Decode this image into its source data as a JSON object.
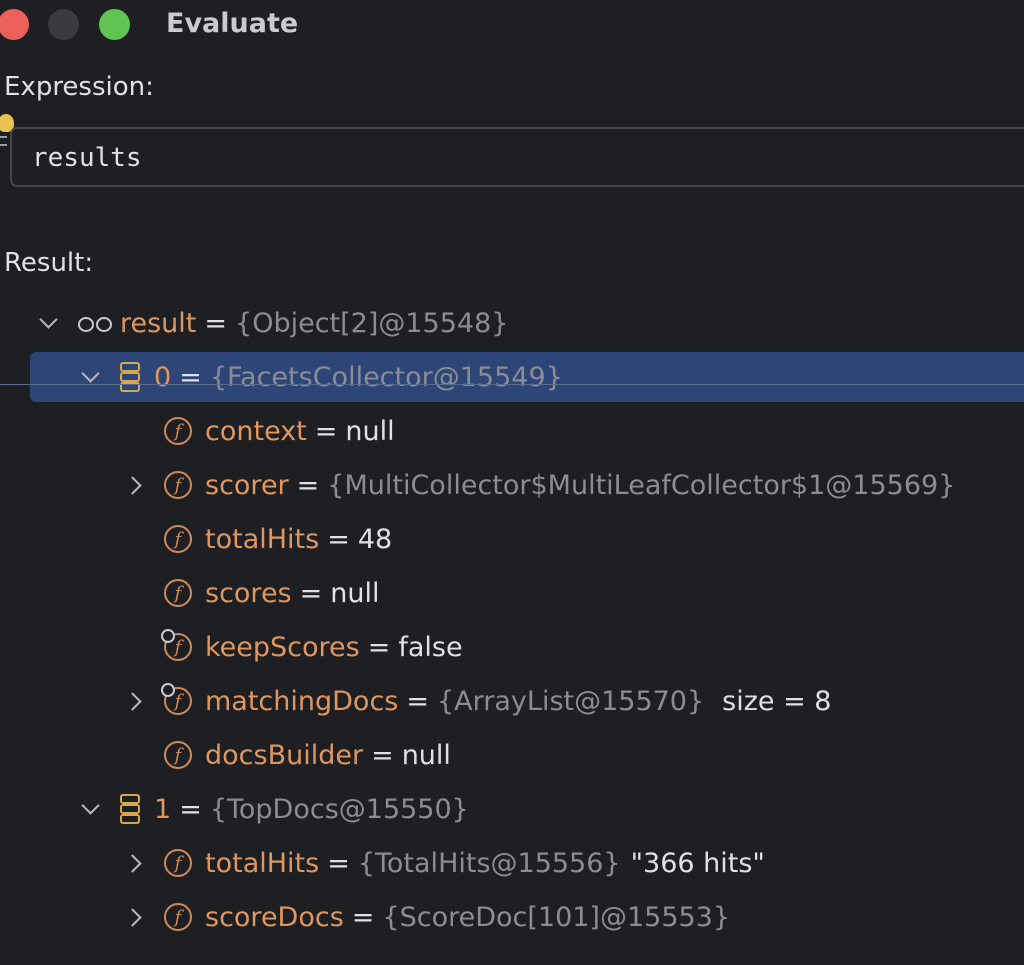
{
  "window": {
    "title": "Evaluate"
  },
  "expression": {
    "label": "Expression:",
    "value": "results"
  },
  "result": {
    "label": "Result:",
    "rows": [
      {
        "name": "result",
        "ref": "{Object[2]@15548}",
        "value": "",
        "extra": ""
      },
      {
        "name": "0",
        "ref": "{FacetsCollector@15549}",
        "value": "",
        "extra": ""
      },
      {
        "name": "context",
        "ref": "",
        "value": "null",
        "extra": ""
      },
      {
        "name": "scorer",
        "ref": "{MultiCollector$MultiLeafCollector$1@15569}",
        "value": "",
        "extra": ""
      },
      {
        "name": "totalHits",
        "ref": "",
        "value": "48",
        "extra": ""
      },
      {
        "name": "scores",
        "ref": "",
        "value": "null",
        "extra": ""
      },
      {
        "name": "keepScores",
        "ref": "",
        "value": "false",
        "extra": ""
      },
      {
        "name": "matchingDocs",
        "ref": "{ArrayList@15570}",
        "value": "",
        "extra": "size = 8"
      },
      {
        "name": "docsBuilder",
        "ref": "",
        "value": "null",
        "extra": ""
      },
      {
        "name": "1",
        "ref": "{TopDocs@15550}",
        "value": "",
        "extra": ""
      },
      {
        "name": "totalHits",
        "ref": "{TotalHits@15556}",
        "value": "",
        "extra": "\"366 hits\""
      },
      {
        "name": "scoreDocs",
        "ref": "{ScoreDoc[101]@15553}",
        "value": "",
        "extra": ""
      }
    ]
  },
  "symbols": {
    "eq": "=",
    "field": "f"
  },
  "icons": {
    "close": "close-icon",
    "minimize": "minimize-icon",
    "maximize": "maximize-icon",
    "watch": "glasses-icon",
    "array": "array-icon",
    "field": "field-icon",
    "final-field": "final-field-icon"
  },
  "colors": {
    "background": "#1e1f22",
    "selection": "#2e4577",
    "field_name": "#e0975f",
    "reference": "#8a8d93"
  }
}
